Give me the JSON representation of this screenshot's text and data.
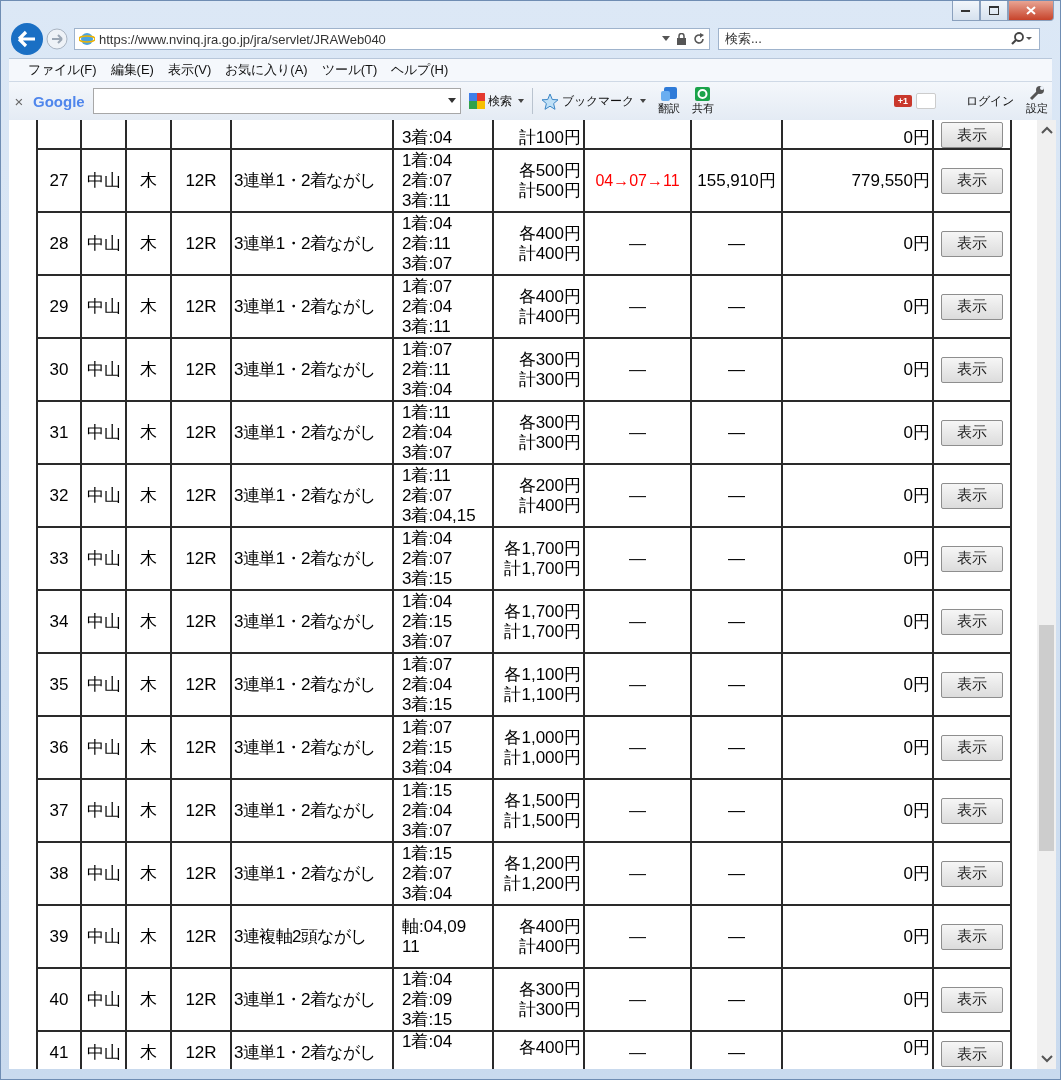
{
  "browser": {
    "url": "https://www.nvinq.jra.go.jp/jra/servlet/JRAWeb040",
    "search_placeholder": "検索..."
  },
  "menu": [
    "ファイル(F)",
    "編集(E)",
    "表示(V)",
    "お気に入り(A)",
    "ツール(T)",
    "ヘルプ(H)"
  ],
  "toolbar": {
    "close": "×",
    "logo": "Google",
    "search": "検索",
    "bookmark": "ブックマーク",
    "translate": "翻訳",
    "share": "共有",
    "plus_one": "+1",
    "login": "ログイン",
    "settings": "設定"
  },
  "rows": [
    {
      "kind": "cut_top",
      "no": "",
      "venue": "",
      "day": "",
      "race": "",
      "type": "",
      "horses": [
        "3着:04"
      ],
      "amounts": [
        "計100円"
      ],
      "result": "",
      "payout": "",
      "total": "0円",
      "button": "表示"
    },
    {
      "kind": "full",
      "no": "27",
      "venue": "中山",
      "day": "木",
      "race": "12R",
      "type": "3連単1・2着ながし",
      "horses": [
        "1着:04",
        "2着:07",
        "3着:11"
      ],
      "amounts": [
        "各500円",
        "計500円"
      ],
      "result": "04→07→11",
      "payout": "155,910円",
      "total": "779,550円",
      "button": "表示"
    },
    {
      "kind": "full",
      "no": "28",
      "venue": "中山",
      "day": "木",
      "race": "12R",
      "type": "3連単1・2着ながし",
      "horses": [
        "1着:04",
        "2着:11",
        "3着:07"
      ],
      "amounts": [
        "各400円",
        "計400円"
      ],
      "result": "—",
      "payout": "—",
      "total": "0円",
      "button": "表示"
    },
    {
      "kind": "full",
      "no": "29",
      "venue": "中山",
      "day": "木",
      "race": "12R",
      "type": "3連単1・2着ながし",
      "horses": [
        "1着:07",
        "2着:04",
        "3着:11"
      ],
      "amounts": [
        "各400円",
        "計400円"
      ],
      "result": "—",
      "payout": "—",
      "total": "0円",
      "button": "表示"
    },
    {
      "kind": "full",
      "no": "30",
      "venue": "中山",
      "day": "木",
      "race": "12R",
      "type": "3連単1・2着ながし",
      "horses": [
        "1着:07",
        "2着:11",
        "3着:04"
      ],
      "amounts": [
        "各300円",
        "計300円"
      ],
      "result": "—",
      "payout": "—",
      "total": "0円",
      "button": "表示"
    },
    {
      "kind": "full",
      "no": "31",
      "venue": "中山",
      "day": "木",
      "race": "12R",
      "type": "3連単1・2着ながし",
      "horses": [
        "1着:11",
        "2着:04",
        "3着:07"
      ],
      "amounts": [
        "各300円",
        "計300円"
      ],
      "result": "—",
      "payout": "—",
      "total": "0円",
      "button": "表示"
    },
    {
      "kind": "full",
      "no": "32",
      "venue": "中山",
      "day": "木",
      "race": "12R",
      "type": "3連単1・2着ながし",
      "horses": [
        "1着:11",
        "2着:07",
        "3着:04,15"
      ],
      "amounts": [
        "各200円",
        "計400円"
      ],
      "result": "—",
      "payout": "—",
      "total": "0円",
      "button": "表示"
    },
    {
      "kind": "full",
      "no": "33",
      "venue": "中山",
      "day": "木",
      "race": "12R",
      "type": "3連単1・2着ながし",
      "horses": [
        "1着:04",
        "2着:07",
        "3着:15"
      ],
      "amounts": [
        "各1,700円",
        "計1,700円"
      ],
      "result": "—",
      "payout": "—",
      "total": "0円",
      "button": "表示"
    },
    {
      "kind": "full",
      "no": "34",
      "venue": "中山",
      "day": "木",
      "race": "12R",
      "type": "3連単1・2着ながし",
      "horses": [
        "1着:04",
        "2着:15",
        "3着:07"
      ],
      "amounts": [
        "各1,700円",
        "計1,700円"
      ],
      "result": "—",
      "payout": "—",
      "total": "0円",
      "button": "表示"
    },
    {
      "kind": "full",
      "no": "35",
      "venue": "中山",
      "day": "木",
      "race": "12R",
      "type": "3連単1・2着ながし",
      "horses": [
        "1着:07",
        "2着:04",
        "3着:15"
      ],
      "amounts": [
        "各1,100円",
        "計1,100円"
      ],
      "result": "—",
      "payout": "—",
      "total": "0円",
      "button": "表示"
    },
    {
      "kind": "full",
      "no": "36",
      "venue": "中山",
      "day": "木",
      "race": "12R",
      "type": "3連単1・2着ながし",
      "horses": [
        "1着:07",
        "2着:15",
        "3着:04"
      ],
      "amounts": [
        "各1,000円",
        "計1,000円"
      ],
      "result": "—",
      "payout": "—",
      "total": "0円",
      "button": "表示"
    },
    {
      "kind": "full",
      "no": "37",
      "venue": "中山",
      "day": "木",
      "race": "12R",
      "type": "3連単1・2着ながし",
      "horses": [
        "1着:15",
        "2着:04",
        "3着:07"
      ],
      "amounts": [
        "各1,500円",
        "計1,500円"
      ],
      "result": "—",
      "payout": "—",
      "total": "0円",
      "button": "表示"
    },
    {
      "kind": "full",
      "no": "38",
      "venue": "中山",
      "day": "木",
      "race": "12R",
      "type": "3連単1・2着ながし",
      "horses": [
        "1着:15",
        "2着:07",
        "3着:04"
      ],
      "amounts": [
        "各1,200円",
        "計1,200円"
      ],
      "result": "—",
      "payout": "—",
      "total": "0円",
      "button": "表示"
    },
    {
      "kind": "full",
      "no": "39",
      "venue": "中山",
      "day": "木",
      "race": "12R",
      "type": "3連複軸2頭ながし",
      "horses": [
        "軸:04,09",
        "11"
      ],
      "amounts": [
        "各400円",
        "計400円"
      ],
      "result": "—",
      "payout": "—",
      "total": "0円",
      "button": "表示"
    },
    {
      "kind": "full",
      "no": "40",
      "venue": "中山",
      "day": "木",
      "race": "12R",
      "type": "3連単1・2着ながし",
      "horses": [
        "1着:04",
        "2着:09",
        "3着:15"
      ],
      "amounts": [
        "各300円",
        "計300円"
      ],
      "result": "—",
      "payout": "—",
      "total": "0円",
      "button": "表示"
    },
    {
      "kind": "cut_bottom",
      "no": "41",
      "venue": "中山",
      "day": "木",
      "race": "12R",
      "type": "3連単1・2着ながし",
      "horses": [
        "1着:04"
      ],
      "amounts": [
        "各400円"
      ],
      "result": "—",
      "payout": "—",
      "total": "0円",
      "button": "表示"
    }
  ]
}
